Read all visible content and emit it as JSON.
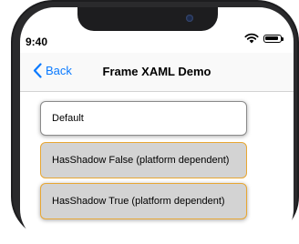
{
  "status_bar": {
    "time": "9:40"
  },
  "nav": {
    "back_label": "Back",
    "title": "Frame XAML Demo"
  },
  "frames": [
    {
      "label": "Default"
    },
    {
      "label": "HasShadow False (platform dependent)"
    },
    {
      "label": "HasShadow True (platform dependent)"
    }
  ],
  "colors": {
    "accent": "#0a7aff",
    "frame_border": "#e8a733",
    "frame_fill": "#d3d3d3"
  },
  "icons": {
    "back": "chevron-left-icon",
    "wifi": "wifi-icon",
    "battery": "battery-icon",
    "camera": "front-camera-icon"
  }
}
